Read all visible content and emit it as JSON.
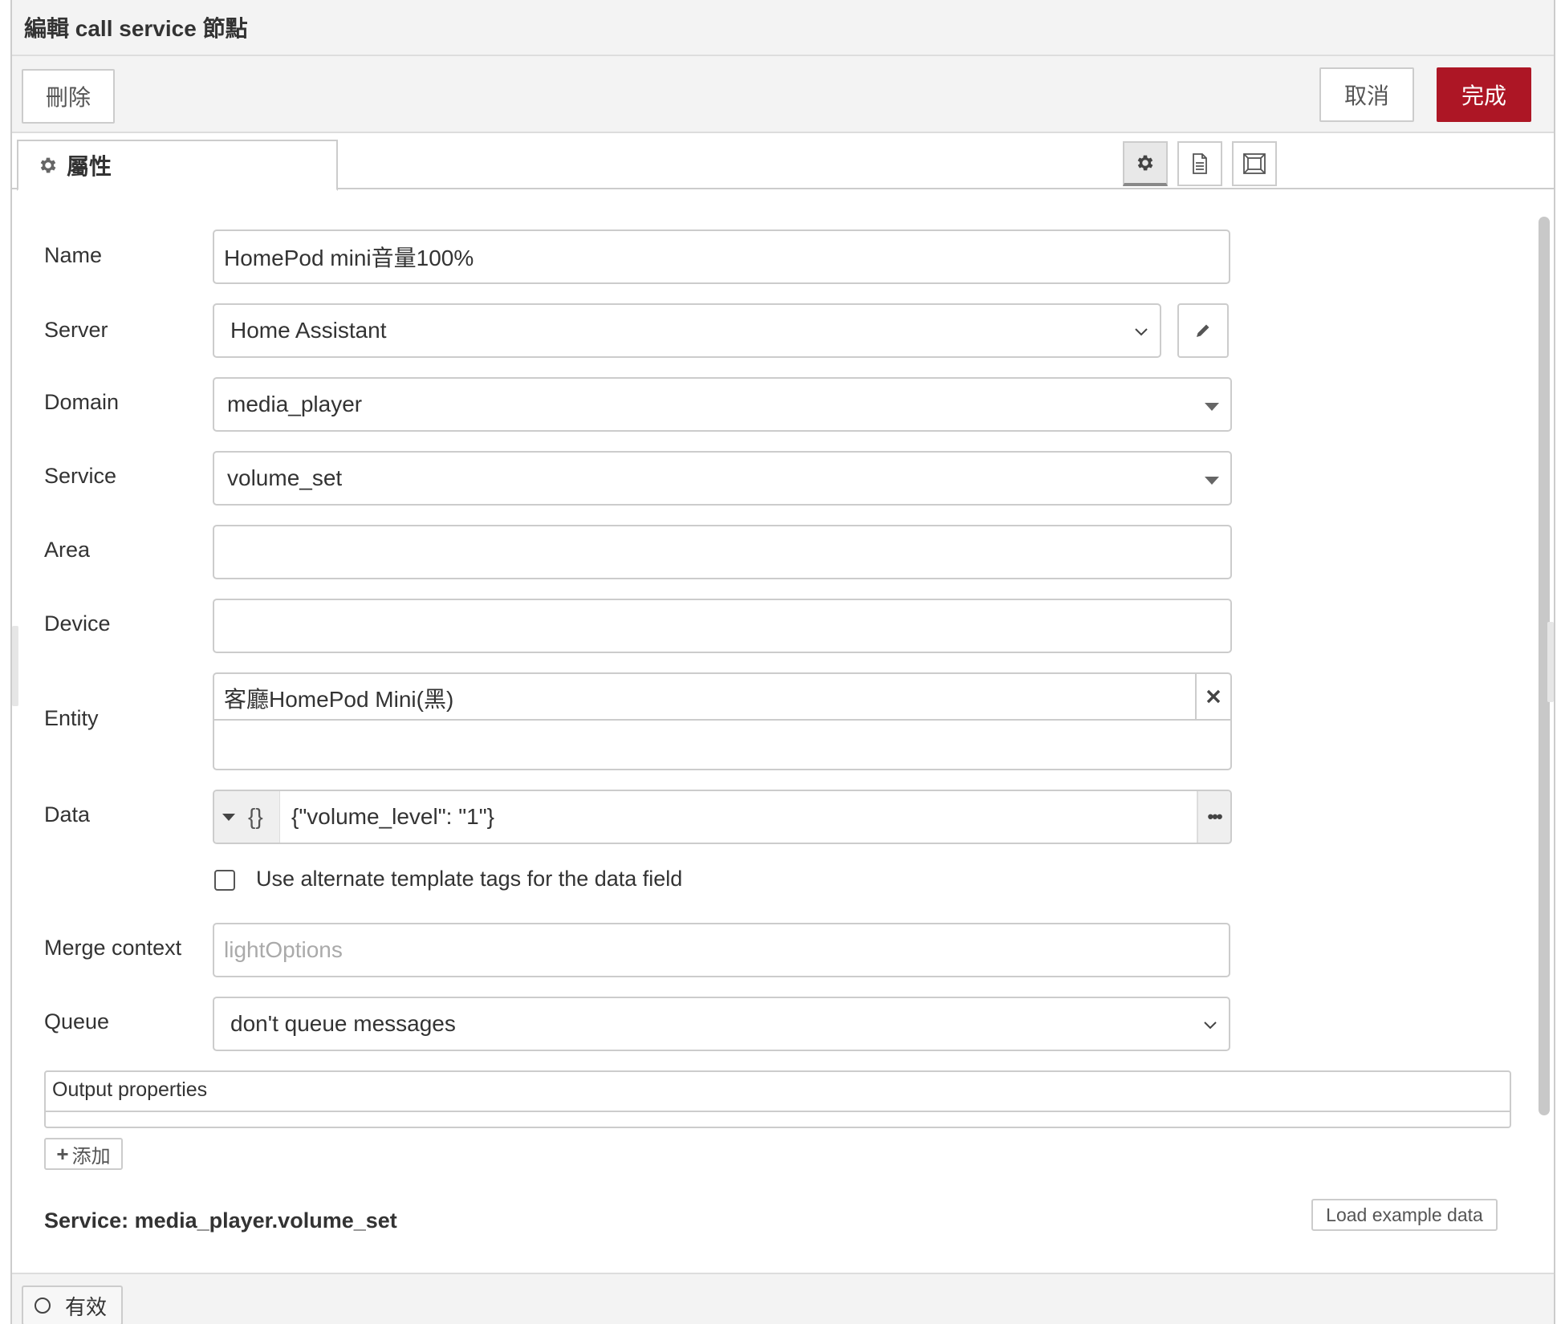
{
  "dialog": {
    "title": "編輯 call service 節點"
  },
  "toolbar": {
    "delete_label": "刪除",
    "cancel_label": "取消",
    "done_label": "完成"
  },
  "tabs": {
    "properties_label": "屬性",
    "icons": [
      "gear-icon",
      "document-icon",
      "frame-icon"
    ]
  },
  "form": {
    "name": {
      "label": "Name",
      "value": "HomePod mini音量100%"
    },
    "server": {
      "label": "Server",
      "value": "Home Assistant"
    },
    "domain": {
      "label": "Domain",
      "value": "media_player"
    },
    "service": {
      "label": "Service",
      "value": "volume_set"
    },
    "area": {
      "label": "Area",
      "value": ""
    },
    "device": {
      "label": "Device",
      "value": ""
    },
    "entity": {
      "label": "Entity",
      "value": "客廳HomePod Mini(黑)"
    },
    "data": {
      "label": "Data",
      "type_symbol": "{}",
      "value": "{\"volume_level\": \"1\"}",
      "more_label": "•••"
    },
    "alt_template": {
      "label": "Use alternate template tags for the data field",
      "checked": false
    },
    "merge_context": {
      "label": "Merge context",
      "placeholder": "lightOptions"
    },
    "queue": {
      "label": "Queue",
      "value": "don't queue messages"
    }
  },
  "output": {
    "title": "Output properties",
    "add_label": "添加"
  },
  "service_info": {
    "heading": "Service: media_player.volume_set",
    "load_label": "Load example data"
  },
  "footer": {
    "enabled_label": "有效"
  },
  "colors": {
    "done_button": "#ad1625",
    "border": "#cccccc",
    "panel_bg": "#f3f3f3"
  }
}
